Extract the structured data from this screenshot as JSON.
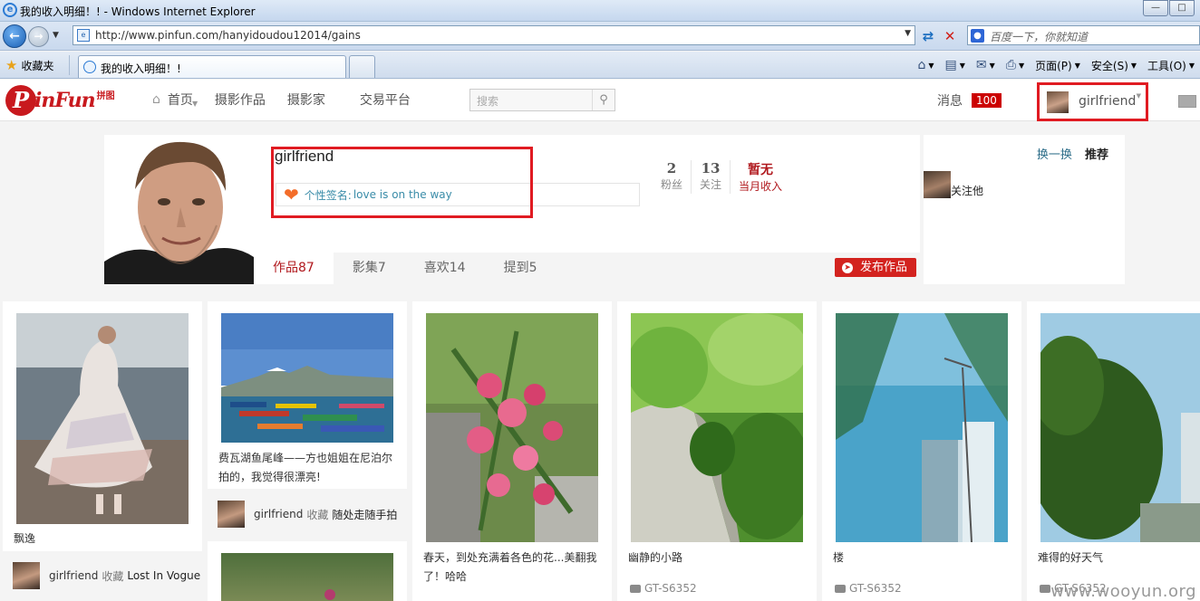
{
  "browser": {
    "window_title": "我的收入明细！! - Windows Internet Explorer",
    "url": "http://www.pinfun.com/hanyidoudou12014/gains",
    "search_placeholder": "百度一下，你就知道",
    "favorites_label": "收藏夹",
    "tab_title": "我的收入明细！!",
    "menu": {
      "page": "页面(P)",
      "safety": "安全(S)",
      "tools": "工具(O)"
    }
  },
  "site": {
    "logo": "PinFun",
    "logo_sub": "拼图",
    "nav": {
      "home": "首页",
      "works": "摄影作品",
      "photographers": "摄影家",
      "trading": "交易平台"
    },
    "search_placeholder": "搜索",
    "messages_label": "消息",
    "messages_count": "100",
    "username": "girlfriend"
  },
  "profile": {
    "name": "girlfriend",
    "signature_label": "个性签名:",
    "signature": "love is on the way",
    "stats": {
      "fans_count": "2",
      "fans_label": "粉丝",
      "follow_count": "13",
      "follow_label": "关注",
      "income_value": "暂无",
      "income_label": "当月收入"
    },
    "tabs": {
      "works": "作品87",
      "albums": "影集7",
      "likes": "喜欢14",
      "mentions": "提到5"
    },
    "publish_label": "发布作品"
  },
  "recommend": {
    "swap": "换一换",
    "title": "推荐",
    "follow_label": "关注他"
  },
  "cards": [
    {
      "caption": "飘逸",
      "user": "girlfriend",
      "action": "收藏",
      "album": "Lost In Vogue"
    },
    {
      "caption": "费瓦湖鱼尾峰——方也姐姐在尼泊尔拍的，我觉得很漂亮!",
      "user": "girlfriend",
      "action": "收藏",
      "album": "随处走随手拍"
    },
    {
      "caption": "春天，到处充满着各色的花...美翻我了！哈哈"
    },
    {
      "caption": "幽静的小路",
      "device": "GT-S6352"
    },
    {
      "caption": "楼",
      "device": "GT-S6352"
    },
    {
      "caption": "难得的好天气",
      "device": "GT-S6352"
    }
  ],
  "watermark": "www.wooyun.org"
}
